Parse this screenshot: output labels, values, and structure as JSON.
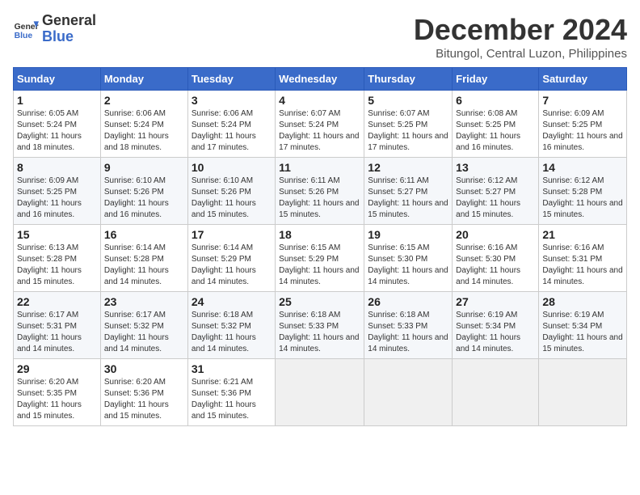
{
  "logo": {
    "line1": "General",
    "line2": "Blue"
  },
  "title": "December 2024",
  "subtitle": "Bitungol, Central Luzon, Philippines",
  "days_of_week": [
    "Sunday",
    "Monday",
    "Tuesday",
    "Wednesday",
    "Thursday",
    "Friday",
    "Saturday"
  ],
  "weeks": [
    [
      {
        "day": "1",
        "detail": "Sunrise: 6:05 AM\nSunset: 5:24 PM\nDaylight: 11 hours and 18 minutes."
      },
      {
        "day": "2",
        "detail": "Sunrise: 6:06 AM\nSunset: 5:24 PM\nDaylight: 11 hours and 18 minutes."
      },
      {
        "day": "3",
        "detail": "Sunrise: 6:06 AM\nSunset: 5:24 PM\nDaylight: 11 hours and 17 minutes."
      },
      {
        "day": "4",
        "detail": "Sunrise: 6:07 AM\nSunset: 5:24 PM\nDaylight: 11 hours and 17 minutes."
      },
      {
        "day": "5",
        "detail": "Sunrise: 6:07 AM\nSunset: 5:25 PM\nDaylight: 11 hours and 17 minutes."
      },
      {
        "day": "6",
        "detail": "Sunrise: 6:08 AM\nSunset: 5:25 PM\nDaylight: 11 hours and 16 minutes."
      },
      {
        "day": "7",
        "detail": "Sunrise: 6:09 AM\nSunset: 5:25 PM\nDaylight: 11 hours and 16 minutes."
      }
    ],
    [
      {
        "day": "8",
        "detail": "Sunrise: 6:09 AM\nSunset: 5:25 PM\nDaylight: 11 hours and 16 minutes."
      },
      {
        "day": "9",
        "detail": "Sunrise: 6:10 AM\nSunset: 5:26 PM\nDaylight: 11 hours and 16 minutes."
      },
      {
        "day": "10",
        "detail": "Sunrise: 6:10 AM\nSunset: 5:26 PM\nDaylight: 11 hours and 15 minutes."
      },
      {
        "day": "11",
        "detail": "Sunrise: 6:11 AM\nSunset: 5:26 PM\nDaylight: 11 hours and 15 minutes."
      },
      {
        "day": "12",
        "detail": "Sunrise: 6:11 AM\nSunset: 5:27 PM\nDaylight: 11 hours and 15 minutes."
      },
      {
        "day": "13",
        "detail": "Sunrise: 6:12 AM\nSunset: 5:27 PM\nDaylight: 11 hours and 15 minutes."
      },
      {
        "day": "14",
        "detail": "Sunrise: 6:12 AM\nSunset: 5:28 PM\nDaylight: 11 hours and 15 minutes."
      }
    ],
    [
      {
        "day": "15",
        "detail": "Sunrise: 6:13 AM\nSunset: 5:28 PM\nDaylight: 11 hours and 15 minutes."
      },
      {
        "day": "16",
        "detail": "Sunrise: 6:14 AM\nSunset: 5:28 PM\nDaylight: 11 hours and 14 minutes."
      },
      {
        "day": "17",
        "detail": "Sunrise: 6:14 AM\nSunset: 5:29 PM\nDaylight: 11 hours and 14 minutes."
      },
      {
        "day": "18",
        "detail": "Sunrise: 6:15 AM\nSunset: 5:29 PM\nDaylight: 11 hours and 14 minutes."
      },
      {
        "day": "19",
        "detail": "Sunrise: 6:15 AM\nSunset: 5:30 PM\nDaylight: 11 hours and 14 minutes."
      },
      {
        "day": "20",
        "detail": "Sunrise: 6:16 AM\nSunset: 5:30 PM\nDaylight: 11 hours and 14 minutes."
      },
      {
        "day": "21",
        "detail": "Sunrise: 6:16 AM\nSunset: 5:31 PM\nDaylight: 11 hours and 14 minutes."
      }
    ],
    [
      {
        "day": "22",
        "detail": "Sunrise: 6:17 AM\nSunset: 5:31 PM\nDaylight: 11 hours and 14 minutes."
      },
      {
        "day": "23",
        "detail": "Sunrise: 6:17 AM\nSunset: 5:32 PM\nDaylight: 11 hours and 14 minutes."
      },
      {
        "day": "24",
        "detail": "Sunrise: 6:18 AM\nSunset: 5:32 PM\nDaylight: 11 hours and 14 minutes."
      },
      {
        "day": "25",
        "detail": "Sunrise: 6:18 AM\nSunset: 5:33 PM\nDaylight: 11 hours and 14 minutes."
      },
      {
        "day": "26",
        "detail": "Sunrise: 6:18 AM\nSunset: 5:33 PM\nDaylight: 11 hours and 14 minutes."
      },
      {
        "day": "27",
        "detail": "Sunrise: 6:19 AM\nSunset: 5:34 PM\nDaylight: 11 hours and 14 minutes."
      },
      {
        "day": "28",
        "detail": "Sunrise: 6:19 AM\nSunset: 5:34 PM\nDaylight: 11 hours and 15 minutes."
      }
    ],
    [
      {
        "day": "29",
        "detail": "Sunrise: 6:20 AM\nSunset: 5:35 PM\nDaylight: 11 hours and 15 minutes."
      },
      {
        "day": "30",
        "detail": "Sunrise: 6:20 AM\nSunset: 5:36 PM\nDaylight: 11 hours and 15 minutes."
      },
      {
        "day": "31",
        "detail": "Sunrise: 6:21 AM\nSunset: 5:36 PM\nDaylight: 11 hours and 15 minutes."
      },
      {
        "day": "",
        "detail": ""
      },
      {
        "day": "",
        "detail": ""
      },
      {
        "day": "",
        "detail": ""
      },
      {
        "day": "",
        "detail": ""
      }
    ]
  ]
}
